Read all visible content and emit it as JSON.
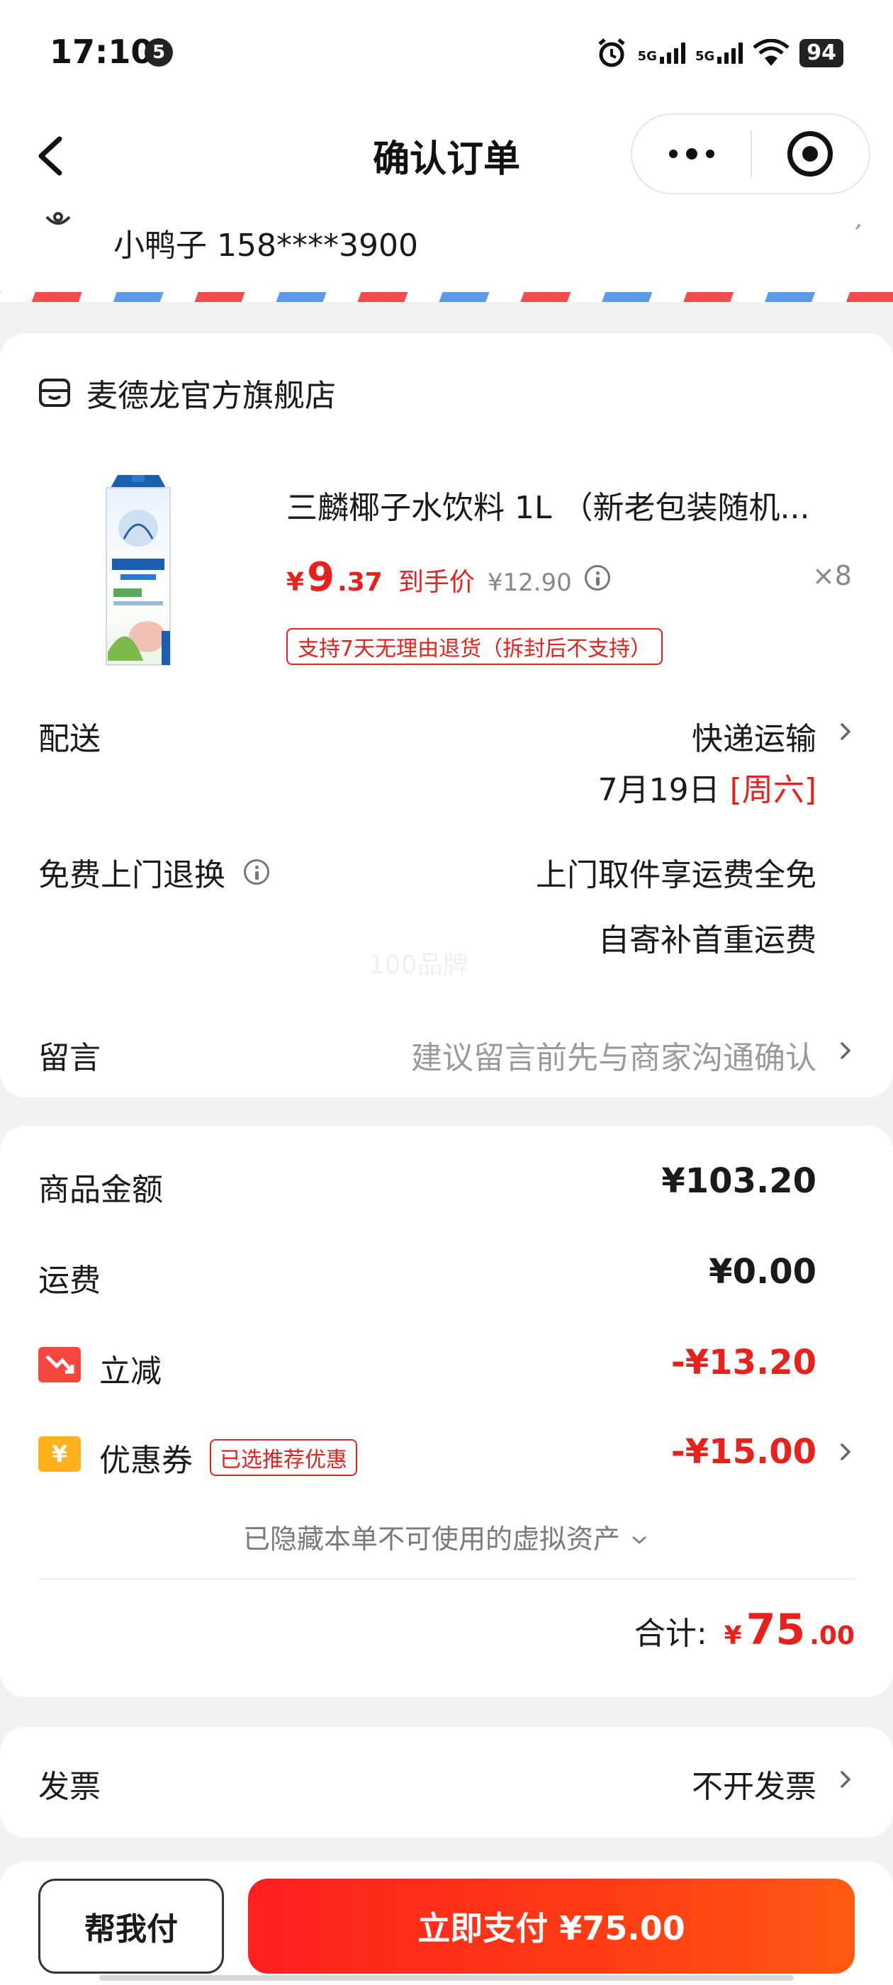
{
  "status_bar": {
    "time": "17:10",
    "notification_count": "5",
    "network_1": "5G",
    "network_2": "5G",
    "battery": "94"
  },
  "nav": {
    "title": "确认订单"
  },
  "address": {
    "recipient": "小鸭子 158****3900"
  },
  "store": {
    "name": "麦德龙官方旗舰店"
  },
  "product": {
    "title": "三麟椰子水饮料 1L （新老包装随机...",
    "price_symbol": "¥",
    "price_int": "9",
    "price_dec": ".37",
    "price_tag": "到手价",
    "original_price": "¥12.90",
    "quantity": "×8",
    "return_policy": "支持7天无理由退货（拆封后不支持）"
  },
  "shipping": {
    "label": "配送",
    "method": "快递运输",
    "date": "7月19日",
    "weekday": "[周六]"
  },
  "free_return": {
    "label": "免费上门退换",
    "line1": "上门取件享运费全免",
    "line2": "自寄补首重运费",
    "watermark": "100品牌"
  },
  "memo": {
    "label": "留言",
    "placeholder": "建议留言前先与商家沟通确认"
  },
  "summary": {
    "goods_label": "商品金额",
    "goods_value": "¥103.20",
    "freight_label": "运费",
    "freight_value": "¥0.00",
    "discount_label": "立减",
    "discount_value": "-¥13.20",
    "coupon_label": "优惠券",
    "coupon_icon_text": "¥",
    "coupon_tag": "已选推荐优惠",
    "coupon_value": "-¥15.00",
    "hidden_assets": "已隐藏本单不可使用的虚拟资产",
    "total_label": "合计:",
    "total_symbol": "¥",
    "total_int": "75",
    "total_dec": ".00"
  },
  "invoice": {
    "label": "发票",
    "value": "不开发票"
  },
  "actions": {
    "help_pay": "帮我付",
    "pay_now": "立即支付 ¥75.00"
  },
  "colors": {
    "accent_red": "#e8211c",
    "pay_gradient_end": "#ff5a12",
    "coupon_yellow": "#ffb21c"
  }
}
